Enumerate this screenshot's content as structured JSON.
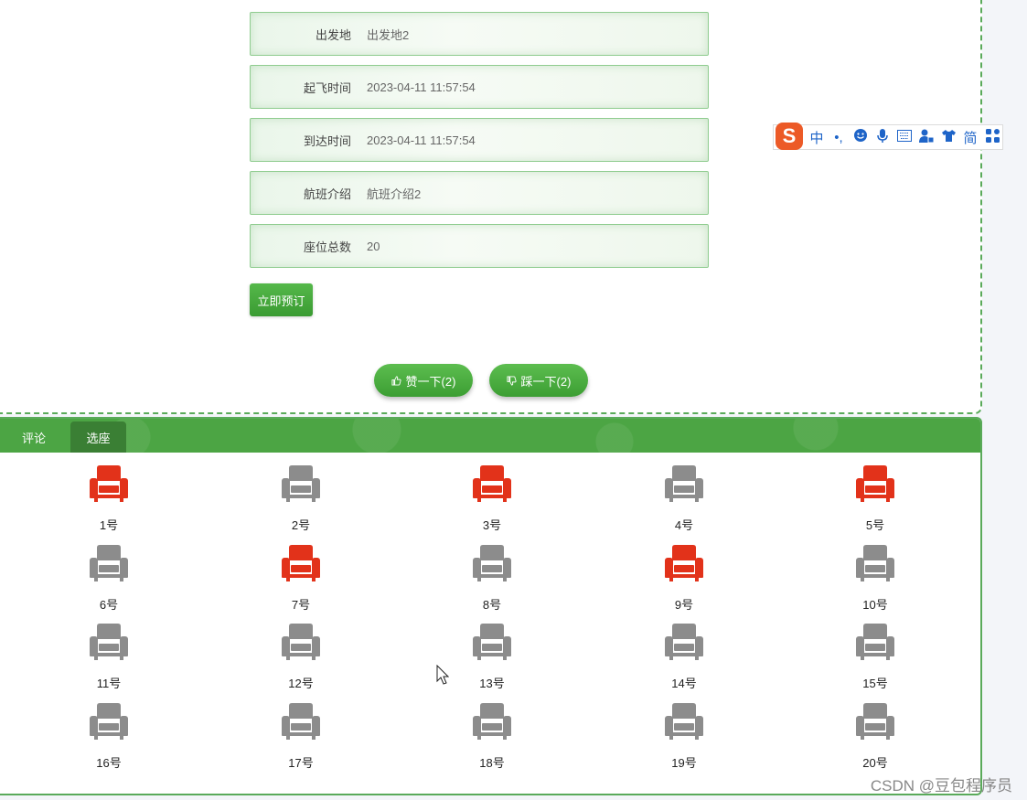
{
  "details": {
    "fields": [
      {
        "label": "出发地",
        "value": "出发地2"
      },
      {
        "label": "起飞时间",
        "value": "2023-04-11 11:57:54"
      },
      {
        "label": "到达时间",
        "value": "2023-04-11 11:57:54"
      },
      {
        "label": "航班介绍",
        "value": "航班介绍2"
      },
      {
        "label": "座位总数",
        "value": "20"
      }
    ],
    "book_label": "立即预订"
  },
  "votes": {
    "like_label": "赞一下(2)",
    "dislike_label": "踩一下(2)"
  },
  "tabs": [
    {
      "label": "评论",
      "active": false
    },
    {
      "label": "选座",
      "active": true
    }
  ],
  "seats": [
    {
      "label": "1号",
      "taken": true
    },
    {
      "label": "2号",
      "taken": false
    },
    {
      "label": "3号",
      "taken": true
    },
    {
      "label": "4号",
      "taken": false
    },
    {
      "label": "5号",
      "taken": true
    },
    {
      "label": "6号",
      "taken": false
    },
    {
      "label": "7号",
      "taken": true
    },
    {
      "label": "8号",
      "taken": false
    },
    {
      "label": "9号",
      "taken": true
    },
    {
      "label": "10号",
      "taken": false
    },
    {
      "label": "11号",
      "taken": false
    },
    {
      "label": "12号",
      "taken": false
    },
    {
      "label": "13号",
      "taken": false
    },
    {
      "label": "14号",
      "taken": false
    },
    {
      "label": "15号",
      "taken": false
    },
    {
      "label": "16号",
      "taken": false
    },
    {
      "label": "17号",
      "taken": false
    },
    {
      "label": "18号",
      "taken": false
    },
    {
      "label": "19号",
      "taken": false
    },
    {
      "label": "20号",
      "taken": false
    }
  ],
  "colors": {
    "seat_taken": "#e2321a",
    "seat_free": "#8c8c8c",
    "accent": "#4ca544"
  },
  "ime_toolbar": {
    "logo": "S",
    "items": [
      "中",
      "•,",
      "smiley-icon",
      "microphone-icon",
      "keyboard-icon",
      "user-icon",
      "shirt-icon",
      "简",
      "grid-icon"
    ]
  },
  "watermark": "CSDN @豆包程序员"
}
